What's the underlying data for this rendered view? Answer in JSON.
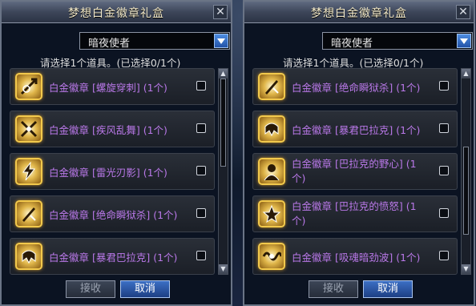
{
  "dialogs": [
    {
      "title": "梦想白金徽章礼盒",
      "close_glyph": "✕",
      "dropdown_value": "暗夜使者",
      "prompt": "请选择1个道具。(已选择0/1个)",
      "items": [
        {
          "label": "白金徽章 [螺旋穿刺] (1个)",
          "icon": "spear-spiral-icon"
        },
        {
          "label": "白金徽章 [疾风乱舞] (1个)",
          "icon": "crossed-blades-icon"
        },
        {
          "label": "白金徽章 [雷光刃影] (1个)",
          "icon": "lightning-icon"
        },
        {
          "label": "白金徽章 [绝命瞬狱杀] (1个)",
          "icon": "dagger-strike-icon"
        },
        {
          "label": "白金徽章 [暴君巴拉克] (1个)",
          "icon": "tyrant-helm-icon"
        }
      ],
      "scroll_up": "▲",
      "scroll_down": "▼",
      "scroll_position": 0.0,
      "buttons": {
        "accept": "接收",
        "cancel": "取消"
      }
    },
    {
      "title": "梦想白金徽章礼盒",
      "close_glyph": "✕",
      "dropdown_value": "暗夜使者",
      "prompt": "请选择1个道具。(已选择0/1个)",
      "items": [
        {
          "label": "白金徽章 [绝命瞬狱杀] (1个)",
          "icon": "dagger-strike-icon"
        },
        {
          "label": "白金徽章 [暴君巴拉克] (1个)",
          "icon": "tyrant-helm-icon"
        },
        {
          "label": "白金徽章 [巴拉克的野心] (1个)",
          "icon": "warrior-ambition-icon"
        },
        {
          "label": "白金徽章 [巴拉克的愤怒] (1个)",
          "icon": "warrior-rage-icon"
        },
        {
          "label": "白金徽章 [吸魂暗劲波] (1个)",
          "icon": "soul-wave-icon"
        }
      ],
      "scroll_up": "▲",
      "scroll_down": "▼",
      "scroll_position": 0.7,
      "buttons": {
        "accept": "接收",
        "cancel": "取消"
      }
    }
  ],
  "colors": {
    "item_text": "#b978e8",
    "title_text": "#f2e9c9",
    "accent_blue": "#3c6fc4"
  }
}
